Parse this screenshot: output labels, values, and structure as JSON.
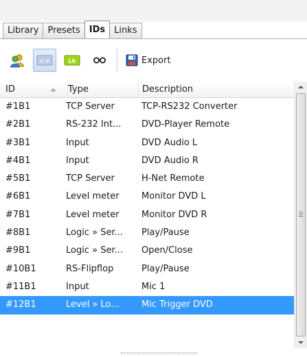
{
  "tabs": [
    {
      "label": "Library",
      "active": false
    },
    {
      "label": "Presets",
      "active": false
    },
    {
      "label": "IDs",
      "active": true
    },
    {
      "label": "Links",
      "active": false
    }
  ],
  "toolbar": {
    "buttons": [
      {
        "icon": "users-icon",
        "pressed": false
      },
      {
        "icon": "id-tag-icon",
        "label": "Id #",
        "pressed": true
      },
      {
        "icon": "label-tag-icon",
        "label": "Lb",
        "pressed": false
      },
      {
        "icon": "link-icon",
        "pressed": false
      }
    ],
    "export_label": "Export",
    "export_icon": "floppy-disk-icon"
  },
  "table": {
    "columns": {
      "id": "ID",
      "type": "Type",
      "description": "Description"
    },
    "sort": {
      "column": "id",
      "direction": "ascending"
    },
    "rows": [
      {
        "id": "#1B1",
        "type": "TCP Server",
        "description": "TCP-RS232 Converter",
        "selected": false
      },
      {
        "id": "#2B1",
        "type": "RS-232 Int...",
        "description": "DVD-Player Remote",
        "selected": false
      },
      {
        "id": "#3B1",
        "type": "Input",
        "description": "DVD Audio L",
        "selected": false
      },
      {
        "id": "#4B1",
        "type": "Input",
        "description": "DVD Audio R",
        "selected": false
      },
      {
        "id": "#5B1",
        "type": "TCP Server",
        "description": "H-Net Remote",
        "selected": false
      },
      {
        "id": "#6B1",
        "type": "Level meter",
        "description": "Monitor DVD L",
        "selected": false
      },
      {
        "id": "#7B1",
        "type": "Level meter",
        "description": "Monitor DVD R",
        "selected": false
      },
      {
        "id": "#8B1",
        "type": "Logic » Ser...",
        "description": "Play/Pause",
        "selected": false
      },
      {
        "id": "#9B1",
        "type": "Logic » Ser...",
        "description": "Open/Close",
        "selected": false
      },
      {
        "id": "#10B1",
        "type": "RS-Flipflop",
        "description": "Play/Pause",
        "selected": false
      },
      {
        "id": "#11B1",
        "type": "Input",
        "description": "Mic 1",
        "selected": false
      },
      {
        "id": "#12B1",
        "type": "Level » Lo...",
        "description": "Mic Trigger DVD",
        "selected": true
      }
    ]
  },
  "colors": {
    "selection": "#3399ff",
    "selection_text": "#ffffff",
    "tab_border": "#a9a9a9",
    "header_bg": "#f1f2f4"
  }
}
